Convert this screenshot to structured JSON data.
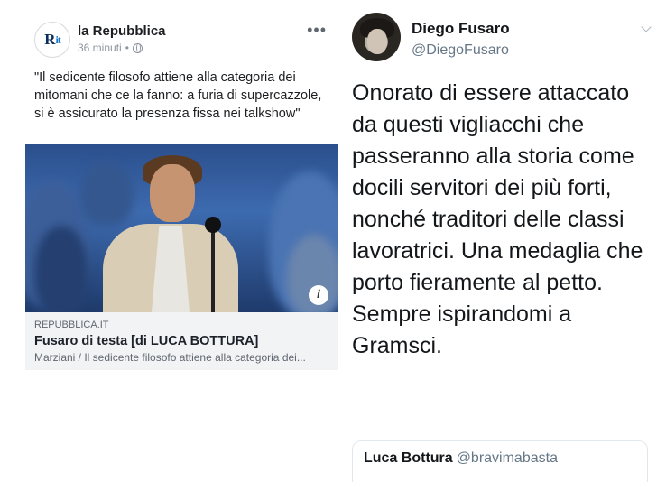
{
  "facebook_post": {
    "page_name": "la Repubblica",
    "logo_text": "R",
    "logo_suffix": "it",
    "time": "36 minuti",
    "separator": "•",
    "more_icon": "more-horizontal-icon",
    "text": "\"Il sedicente filosofo attiene alla categoria dei mitomani che ce la fanno: a furia di supercazzole, si è assicurato la presenza fissa nei talkshow\"",
    "link": {
      "domain": "REPUBBLICA.IT",
      "title": "Fusaro di testa [di LUCA BOTTURA]",
      "description": "Marziani / Il sedicente filosofo attiene alla categoria dei..."
    },
    "info_button": "i"
  },
  "tweet": {
    "name": "Diego Fusaro",
    "handle": "@DiegoFusaro",
    "text": "Onorato di essere attaccato da questi vigliacchi che passeranno alla storia come docili servitori dei più forti, nonché traditori delle classi lavoratrici. Una medaglia che porto fieramente al petto. Sempre ispirandomi a Gramsci.",
    "quoted": {
      "name": "Luca Bottura",
      "handle": "@bravimabasta"
    }
  },
  "colors": {
    "facebook_meta": "#8d949e",
    "link_preview_bg": "#f2f3f5",
    "twitter_handle": "#657786"
  }
}
